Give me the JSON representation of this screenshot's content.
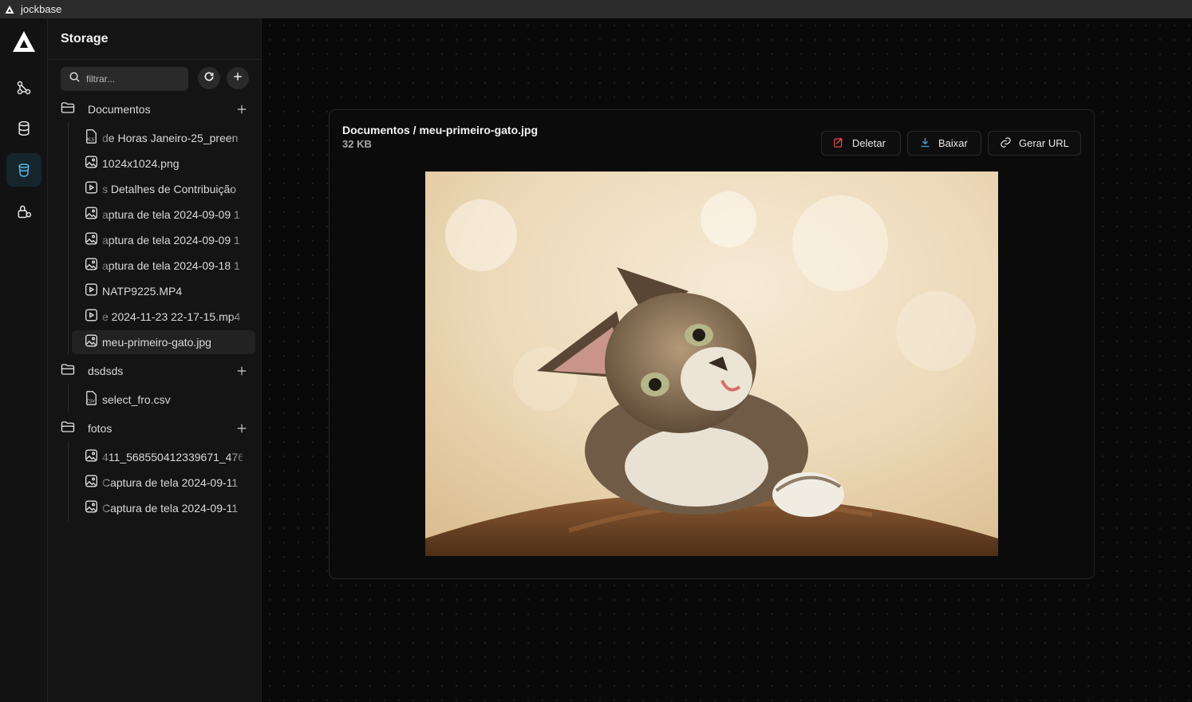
{
  "window": {
    "title": "jockbase"
  },
  "rail": {
    "items": [
      "logo",
      "graph-icon",
      "database-icon",
      "storage-icon",
      "lock-icon"
    ]
  },
  "sidebar": {
    "title": "Storage",
    "search_placeholder": "filtrar...",
    "folders": [
      {
        "name": "Documentos",
        "files": [
          {
            "name": "de Horas Janeiro-25_preen",
            "icon": "xls-file-icon"
          },
          {
            "name": "1024x1024.png",
            "icon": "image-file-icon"
          },
          {
            "name": "s Detalhes de Contribuição",
            "icon": "video-file-icon"
          },
          {
            "name": "aptura de tela 2024-09-09 1",
            "icon": "image-file-icon"
          },
          {
            "name": "aptura de tela 2024-09-09 1",
            "icon": "image-file-icon"
          },
          {
            "name": "aptura de tela 2024-09-18 1",
            "icon": "image-file-icon"
          },
          {
            "name": "NATP9225.MP4",
            "icon": "video-file-icon"
          },
          {
            "name": "e 2024-11-23 22-17-15.mp4",
            "icon": "video-file-icon"
          },
          {
            "name": "meu-primeiro-gato.jpg",
            "icon": "image-file-icon",
            "selected": true
          }
        ]
      },
      {
        "name": "dsdsds",
        "files": [
          {
            "name": "select_fro.csv",
            "icon": "csv-file-icon"
          }
        ]
      },
      {
        "name": "fotos",
        "files": [
          {
            "name": "411_568550412339671_476",
            "icon": "image-file-icon"
          },
          {
            "name": "Captura de tela 2024-09-11",
            "icon": "image-file-icon"
          },
          {
            "name": "Captura de tela 2024-09-11",
            "icon": "image-file-icon"
          }
        ]
      }
    ]
  },
  "preview": {
    "path": "Documentos / meu-primeiro-gato.jpg",
    "size": "32 KB",
    "buttons": {
      "delete": "Deletar",
      "download": "Baixar",
      "url": "Gerar URL"
    },
    "colors": {
      "delete_icon": "#e5484d",
      "download_icon": "#4aa3df"
    }
  }
}
